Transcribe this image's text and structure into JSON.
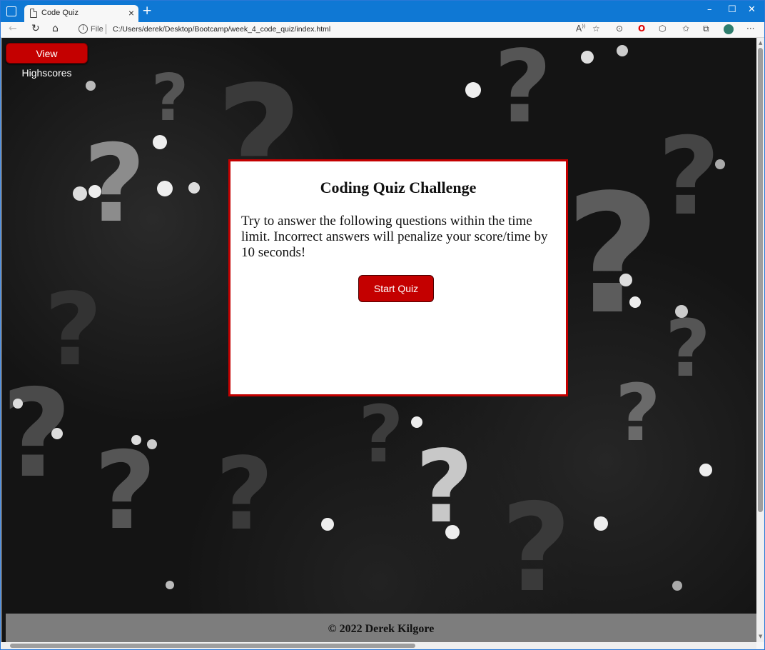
{
  "browser": {
    "tab_title": "Code Quiz",
    "new_tab": "+",
    "file_label": "File",
    "url": "C:/Users/derek/Desktop/Bootcamp/week_4_code_quiz/index.html",
    "controls": {
      "minimize": "–",
      "maximize": "☐",
      "close": "✕",
      "tab_close": "×"
    },
    "nav": {
      "back": "←",
      "refresh": "↻",
      "home": "⌂",
      "info": "i"
    },
    "toolbar_icons": [
      "read-aloud-icon",
      "favorite-add-icon",
      "search-icon",
      "opera-icon",
      "extensions-icon",
      "favorites-icon",
      "collections-icon",
      "profile-icon",
      "more-icon"
    ]
  },
  "page": {
    "highscores_label": "View Highscores",
    "quiz_title": "Coding Quiz Challenge",
    "quiz_description": "Try to answer the following questions within the time limit. Incorrect answers will penalize your score/time by 10 seconds!",
    "start_label": "Start Quiz",
    "footer_text": "© 2022 Derek Kilgore"
  },
  "colors": {
    "accent_red": "#c40000",
    "titlebar_blue": "#0f78d4",
    "footer_gray": "#7d7d7d"
  }
}
